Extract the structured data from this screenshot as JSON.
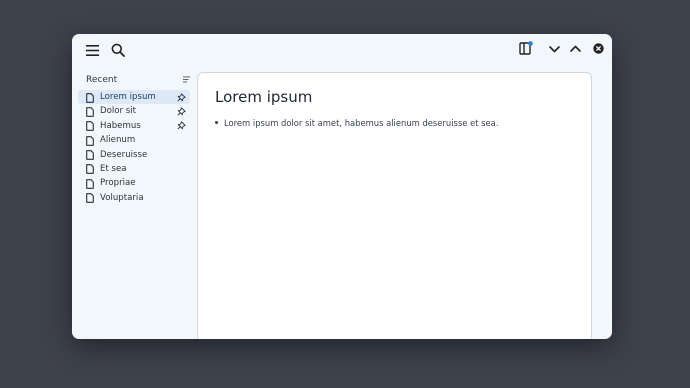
{
  "header": {
    "icons": [
      "hamburger-menu-icon",
      "search-icon",
      "sidebar-panel-icon",
      "chevron-down-icon",
      "chevron-up-icon",
      "close-icon"
    ]
  },
  "sidebar": {
    "title": "Recent",
    "items": [
      {
        "label": "Lorem ipsum",
        "pinned": true,
        "active": true
      },
      {
        "label": "Dolor sit",
        "pinned": true
      },
      {
        "label": "Habemus",
        "pinned": true
      },
      {
        "label": "Alienum"
      },
      {
        "label": "Deseruisse"
      },
      {
        "label": "Et sea"
      },
      {
        "label": "Propriae"
      },
      {
        "label": "Voluptaria"
      }
    ]
  },
  "main": {
    "title": "Lorem ipsum",
    "bullet": "Lorem ipsum dolor sit amet, habemus alienum deseruisse et sea."
  },
  "colors": {
    "accent": "#1f3f66",
    "active_bg": "#dde9f6",
    "notification_dot": "#2f7ad6"
  }
}
